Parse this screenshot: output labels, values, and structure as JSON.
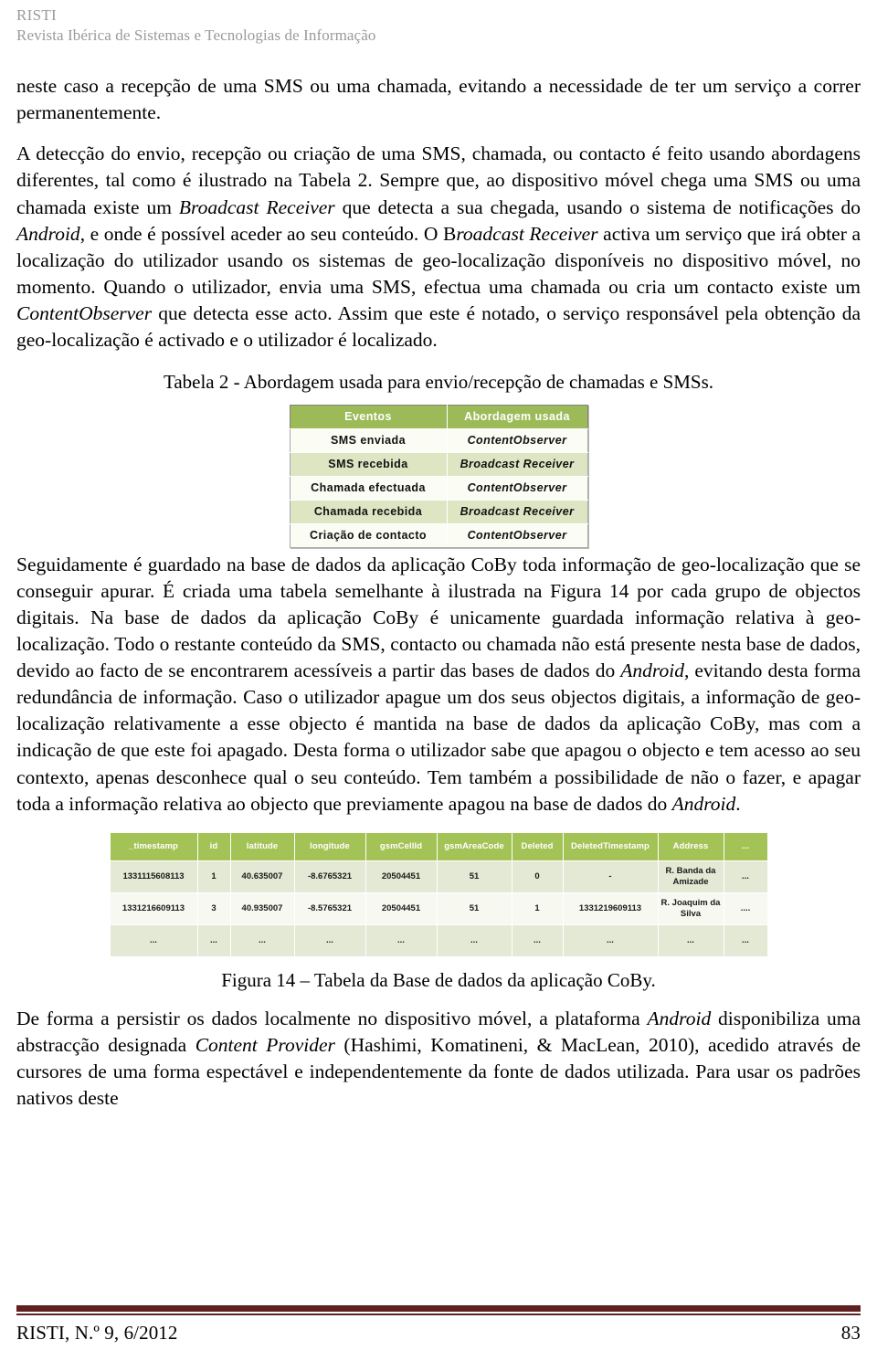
{
  "running_head": {
    "journal_abbr": "RISTI",
    "journal_name": "Revista Ibérica de Sistemas e Tecnologias de Informação"
  },
  "paragraphs": {
    "p1_a": "neste caso a recepção de uma SMS ou uma chamada, evitando a necessidade de ter um serviço a correr permanentemente.",
    "p2_a": "A detecção do envio, recepção ou criação de uma SMS, chamada, ou contacto é feito usando abordagens diferentes, tal como é ilustrado na Tabela 2. Sempre que, ao dispositivo móvel chega uma SMS ou uma chamada existe um ",
    "p2_i1": "Broadcast Receiver",
    "p2_b": " que detecta a sua chegada, usando o sistema de notificações do ",
    "p2_i2": "Android",
    "p2_c": ", e onde é possível aceder ao seu conteúdo. O B",
    "p2_i3": "roadcast Receiver",
    "p2_d": " activa um serviço que irá obter a localização do utilizador usando os sistemas de geo-localização disponíveis no dispositivo móvel, no momento. Quando o utilizador, envia uma SMS, efectua uma chamada ou cria um contacto existe um ",
    "p2_i4": "ContentObserver",
    "p2_e": " que detecta esse acto. Assim que este é notado, o serviço responsável pela obtenção da geo-localização é activado e o utilizador é localizado.",
    "p3_a": "Seguidamente é guardado na base de dados da aplicação CoBy toda informação de geo-localização que se conseguir apurar. É criada uma tabela semelhante à ilustrada na Figura 14 por cada grupo de objectos digitais. Na base de dados da aplicação CoBy é unicamente guardada informação relativa à geo-localização. Todo o restante conteúdo da SMS, contacto ou chamada não está presente nesta base de dados, devido ao facto de se encontrarem acessíveis a partir das bases de dados do ",
    "p3_i1": "Android",
    "p3_b": ", evitando desta forma redundância de informação. Caso o utilizador apague um dos seus objectos digitais, a informação de geo-localização relativamente a esse objecto é mantida na base de dados da aplicação CoBy, mas com a indicação de que este foi apagado. Desta forma o utilizador sabe que apagou o objecto e tem acesso ao seu contexto, apenas desconhece qual o seu conteúdo. Tem também a possibilidade de não o fazer, e apagar toda a informação relativa ao objecto que previamente apagou na base de dados do ",
    "p3_i2": "Android",
    "p3_c": ".",
    "p4_a": "De forma a persistir os dados localmente no dispositivo móvel, a plataforma ",
    "p4_i1": "Android",
    "p4_b": " disponibiliza uma abstracção designada ",
    "p4_i2": "Content Provider",
    "p4_c": " (Hashimi, Komatineni, & MacLean, 2010), acedido através de cursores de uma forma espectável e independentemente da fonte de dados utilizada. Para usar os padrões nativos deste"
  },
  "table2": {
    "caption": "Tabela 2 - Abordagem usada para envio/recepção de chamadas e SMSs.",
    "headers": [
      "Eventos",
      "Abordagem usada"
    ],
    "rows": [
      [
        "SMS enviada",
        "ContentObserver"
      ],
      [
        "SMS recebida",
        "Broadcast Receiver"
      ],
      [
        "Chamada efectuada",
        "ContentObserver"
      ],
      [
        "Chamada recebida",
        "Broadcast Receiver"
      ],
      [
        "Criação de contacto",
        "ContentObserver"
      ]
    ]
  },
  "figure14": {
    "caption": "Figura 14 – Tabela da Base de dados da aplicação CoBy.",
    "headers": [
      "_timestamp",
      "id",
      "latitude",
      "longitude",
      "gsmCellId",
      "gsmAreaCode",
      "Deleted",
      "DeletedTimestamp",
      "Address",
      "..."
    ],
    "rows": [
      [
        "1331115608113",
        "1",
        "40.635007",
        "-8.6765321",
        "20504451",
        "51",
        "0",
        "-",
        "R. Banda da Amizade",
        "..."
      ],
      [
        "1331216609113",
        "3",
        "40.935007",
        "-8.5765321",
        "20504451",
        "51",
        "1",
        "1331219609113",
        "R. Joaquim da Silva",
        "...."
      ],
      [
        "...",
        "...",
        "...",
        "...",
        "...",
        "...",
        "...",
        "...",
        "...",
        "..."
      ]
    ]
  },
  "footer": {
    "left": "RISTI, N.º 9, 6/2012",
    "right": "83"
  },
  "colors": {
    "header_green": "#9cbb58",
    "fig_header_green": "#a4c356",
    "row_light": "#fbfcf3",
    "row_green": "#dde5c3",
    "fig_row_green": "#e3e9d4",
    "fig_row_light": "#f7f9f1",
    "footer_rule": "#602020",
    "running_head_gray": "#9a9a9a"
  }
}
